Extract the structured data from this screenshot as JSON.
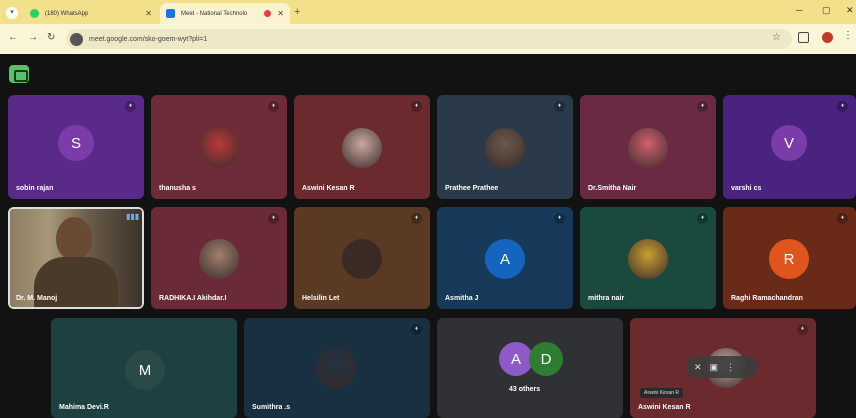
{
  "browser": {
    "tabs": [
      {
        "title": "(180) WhatsApp",
        "favicon_color": "#25d366"
      },
      {
        "title": "Meet - National Technolo",
        "favicon_color": "#1a73e8"
      }
    ],
    "url": "meet.google.com/sko-goem-wyt?pli=1"
  },
  "tiles": [
    {
      "name": "sobin rajan",
      "initial": "S",
      "type": "initial",
      "bg": "#5a2a8a",
      "avatar_bg": "#7a3ca8"
    },
    {
      "name": "thanusha s",
      "type": "photo",
      "bg": "#6e2b3a",
      "photo_color": "#b83a3a"
    },
    {
      "name": "Aswini Kesan R",
      "type": "photo",
      "bg": "#6a2a2e",
      "photo_color": "#c9a8a0"
    },
    {
      "name": "Prathee Prathee",
      "type": "photo",
      "bg": "#2a3a4a",
      "photo_color": "#6a5a4a"
    },
    {
      "name": "Dr.Smitha Nair",
      "type": "photo",
      "bg": "#6a2a44",
      "photo_color": "#d06070"
    },
    {
      "name": "varshi cs",
      "initial": "V",
      "type": "initial",
      "bg": "#4a2280",
      "avatar_bg": "#7a3ca8"
    },
    {
      "name": "Dr. M. Manoj",
      "type": "camera",
      "bg": "#5b4a3a"
    },
    {
      "name": "RADHIKA.I Akihdar.I",
      "type": "photo",
      "bg": "#6a2a38",
      "photo_color": "#a08070"
    },
    {
      "name": "Helsilin Let",
      "type": "photo",
      "bg": "#5a3a22",
      "photo_color": "#3a2a20"
    },
    {
      "name": "Asmitha J",
      "initial": "A",
      "type": "initial",
      "bg": "#173a5a",
      "avatar_bg": "#1565c0"
    },
    {
      "name": "mithra nair",
      "type": "photo",
      "bg": "#1a4a3e",
      "photo_color": "#c9a030"
    },
    {
      "name": "Raghi Ramachandran",
      "initial": "R",
      "type": "initial",
      "bg": "#6a2a18",
      "avatar_bg": "#e0551e"
    },
    {
      "name": "Mahima Devi.R",
      "initial": "M",
      "type": "initial",
      "bg": "#1d4040",
      "avatar_bg": "#2a4a4a"
    },
    {
      "name": "Sumithra .s",
      "type": "photo",
      "bg": "#183040",
      "photo_color": "#223344"
    },
    {
      "name": "Aswini Kesan R",
      "type": "photo",
      "bg": "#6a2a2e",
      "photo_color": "#c9a8a0"
    }
  ],
  "others": {
    "label": "43 others",
    "initial_a": "A",
    "initial_d": "D",
    "color_a": "#8e5ac8",
    "color_d": "#2e7d32"
  },
  "tooltip": "Aswini Kesan R"
}
